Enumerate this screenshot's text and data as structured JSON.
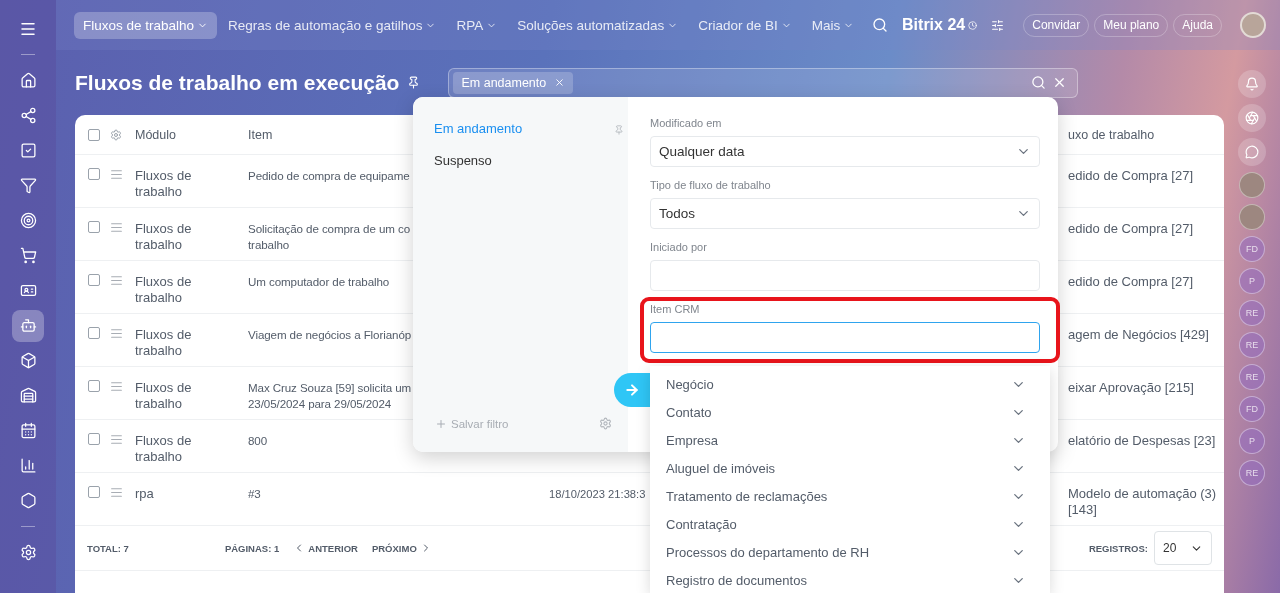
{
  "top_nav": {
    "tabs": [
      {
        "label": "Fluxos de trabalho",
        "selected": true
      },
      {
        "label": "Regras de automação e gatilhos",
        "selected": false
      },
      {
        "label": "RPA",
        "selected": false
      },
      {
        "label": "Soluções automatizadas",
        "selected": false
      },
      {
        "label": "Criador de BI",
        "selected": false
      },
      {
        "label": "Mais",
        "selected": false
      }
    ],
    "logo": {
      "name": "Bitrix",
      "number": "24"
    },
    "buttons": [
      "Convidar",
      "Meu plano",
      "Ajuda"
    ]
  },
  "sidebar": {
    "items": [
      {
        "selected": false
      },
      {
        "selected": false
      },
      {
        "selected": false
      },
      {
        "selected": false
      },
      {
        "selected": false
      },
      {
        "selected": false
      },
      {
        "selected": false
      },
      {
        "selected": true
      },
      {
        "selected": false
      },
      {
        "selected": false
      },
      {
        "selected": false
      },
      {
        "selected": false
      },
      {
        "selected": false
      },
      {
        "selected": false
      }
    ]
  },
  "page": {
    "title": "Fluxos de trabalho em execução",
    "search": {
      "chips": [
        "Em andamento"
      ]
    }
  },
  "table": {
    "all_checked": false,
    "columns": [
      "Módulo",
      "Item",
      "",
      "uxo de trabalho"
    ],
    "rows": [
      {
        "checked": false,
        "module": "Fluxos de trabalho",
        "item": [
          "Pedido de compra de equipame"
        ],
        "column_3": "",
        "column_4": "edido de Compra [27]"
      },
      {
        "checked": false,
        "module": "Fluxos de trabalho",
        "item": [
          "Solicitação de compra de um co",
          "trabalho"
        ],
        "column_3": "",
        "column_4": "edido de Compra [27]"
      },
      {
        "checked": false,
        "module": "Fluxos de trabalho",
        "item": [
          "Um computador de trabalho"
        ],
        "column_3": "",
        "column_4": "edido de Compra [27]"
      },
      {
        "checked": false,
        "module": "Fluxos de trabalho",
        "item": [
          "Viagem de negócios a Florianóp"
        ],
        "column_3": "",
        "column_4": "agem de Negócios [429]"
      },
      {
        "checked": false,
        "module": "Fluxos de trabalho",
        "item": [
          "Max Cruz Souza [59] solicita um",
          "23/05/2024 para 29/05/2024"
        ],
        "column_3": "",
        "column_4": "eixar Aprovação [215]"
      },
      {
        "checked": false,
        "module": "Fluxos de trabalho",
        "item": [
          "800"
        ],
        "column_3": "",
        "column_4": "elatório de Despesas [23]"
      },
      {
        "checked": false,
        "module": "rpa",
        "item": [
          "#3"
        ],
        "column_3": "18/10/2023 21:38:3",
        "column_4": "Modelo de automação (3) [143]"
      }
    ],
    "footer": {
      "total_label": "TOTAL:",
      "total": "7",
      "pages_label": "PÁGINAS:",
      "pages": "1",
      "previous": "ANTERIOR",
      "next": "PRÓXIMO",
      "records_label": "REGISTROS:",
      "records": "20"
    }
  },
  "filter_popup": {
    "presets": [
      {
        "label": "Em andamento",
        "selected": true
      },
      {
        "label": "Suspenso",
        "selected": false
      }
    ],
    "save_filter": "Salvar filtro",
    "fields": [
      {
        "kind": "select",
        "label": "Modificado em",
        "value": "Qualquer data",
        "focused": false
      },
      {
        "kind": "select",
        "label": "Tipo de fluxo de trabalho",
        "value": "Todos",
        "focused": false
      },
      {
        "kind": "input",
        "label": "Iniciado por",
        "focused": false
      },
      {
        "kind": "input",
        "label": "Item CRM",
        "focused": true
      }
    ],
    "crm_options": [
      "Negócio",
      "Contato",
      "Empresa",
      "Aluguel de imóveis",
      "Tratamento de reclamações",
      "Contratação",
      "Processos do departamento de RH",
      "Registro de documentos"
    ]
  },
  "right_rail": {
    "avatars": [
      {
        "kind": "photo"
      },
      {
        "kind": "photo"
      },
      {
        "kind": "initials",
        "text": "FD"
      },
      {
        "kind": "initials",
        "text": "P"
      },
      {
        "kind": "initials",
        "text": "RE"
      },
      {
        "kind": "initials",
        "text": "RE"
      },
      {
        "kind": "initials",
        "text": "RE"
      },
      {
        "kind": "initials",
        "text": "FD"
      },
      {
        "kind": "initials",
        "text": "P"
      },
      {
        "kind": "initials",
        "text": "RE"
      }
    ]
  }
}
